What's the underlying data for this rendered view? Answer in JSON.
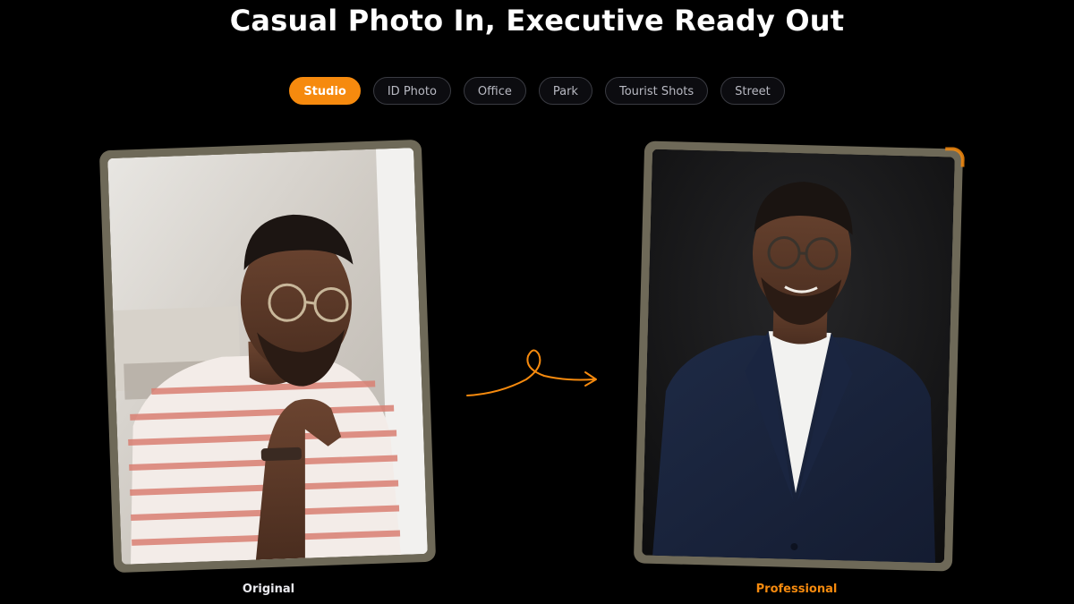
{
  "headline": "Casual Photo In, Executive Ready Out",
  "tabs": [
    {
      "label": "Studio",
      "active": true
    },
    {
      "label": "ID Photo",
      "active": false
    },
    {
      "label": "Office",
      "active": false
    },
    {
      "label": "Park",
      "active": false
    },
    {
      "label": "Tourist Shots",
      "active": false
    },
    {
      "label": "Street",
      "active": false
    }
  ],
  "original_caption": "Original",
  "result_caption": "Professional",
  "colors": {
    "accent": "#f68a0e",
    "background": "#000000",
    "frame": "#6e6958"
  },
  "icons": {
    "transform_arrow": "curly-arrow-right-icon"
  }
}
